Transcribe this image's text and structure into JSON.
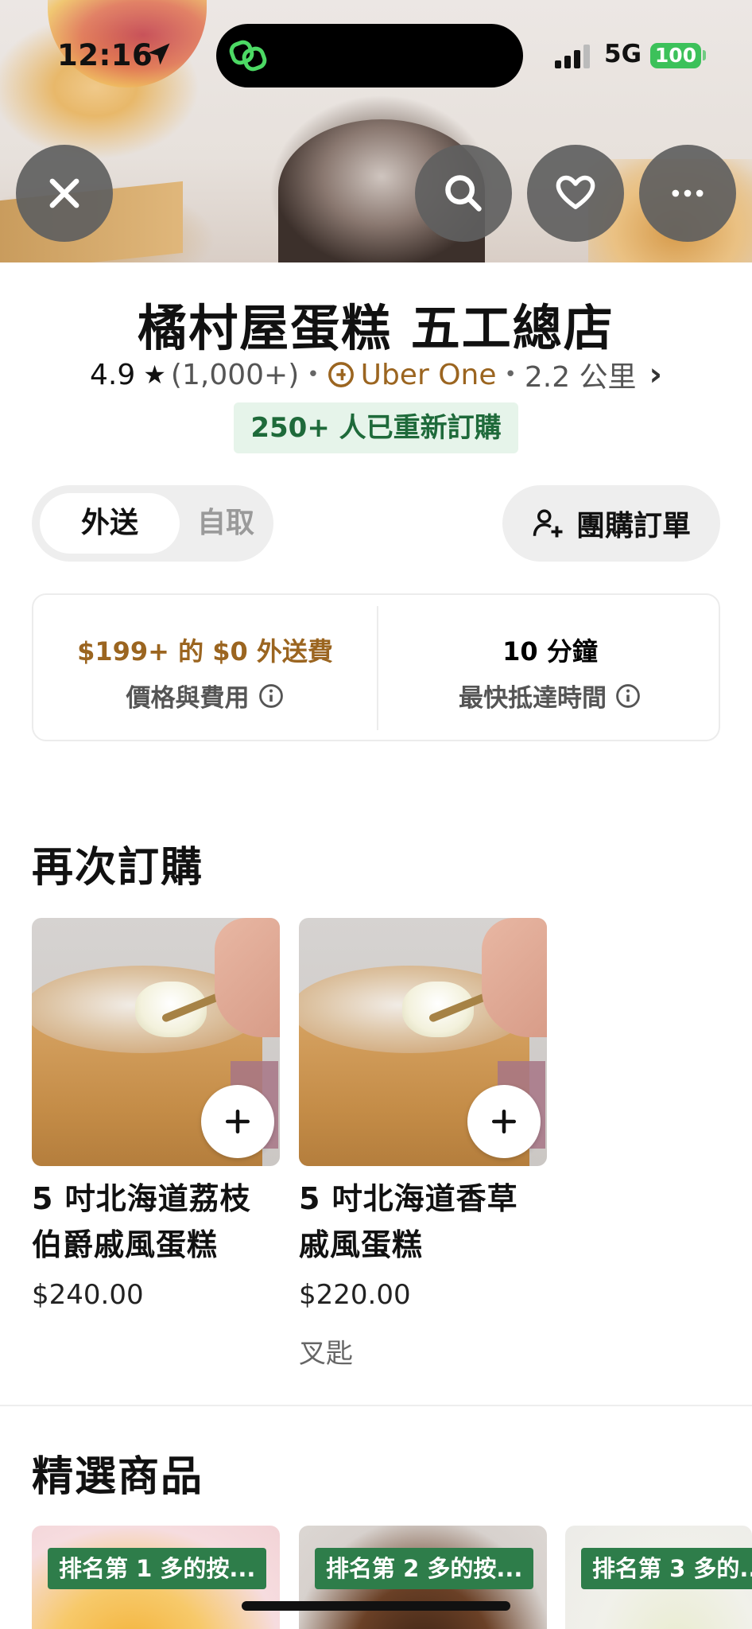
{
  "status_bar": {
    "time": "12:16",
    "network": "5G",
    "battery": "100"
  },
  "store": {
    "name": "橘村屋蛋糕 五工總店",
    "rating": "4.9",
    "review_count": "(1,000+)",
    "membership": "Uber One",
    "distance": "2.2 公里",
    "reorder_badge": "250+ 人已重新訂購"
  },
  "mode_toggle": {
    "delivery": "外送",
    "pickup": "自取",
    "selected": "外送"
  },
  "group_order": {
    "label": "團購訂單"
  },
  "info": {
    "fee_title": "$199+ 的 $0 外送費",
    "fee_sub": "價格與費用",
    "time_title": "10 分鐘",
    "time_sub": "最快抵達時間"
  },
  "buy_again": {
    "title": "再次訂購",
    "items": [
      {
        "name": "5 吋北海道荔枝伯爵戚風蛋糕",
        "price": "$240.00",
        "note": ""
      },
      {
        "name": "5 吋北海道香草戚風蛋糕",
        "price": "$220.00",
        "note": "叉匙"
      }
    ]
  },
  "featured": {
    "title": "精選商品",
    "items": [
      {
        "badge": "排名第 1 多的按..."
      },
      {
        "badge": "排名第 2 多的按..."
      },
      {
        "badge": "排名第 3 多的..."
      }
    ]
  },
  "colors": {
    "accent_brown": "#9b6520",
    "badge_green": "#2e7d4a",
    "reorder_bg": "#e6f4ea",
    "battery_green": "#3cc15a"
  },
  "icons": [
    "location-arrow-icon",
    "link-icon",
    "signal-icon",
    "close-icon",
    "search-icon",
    "heart-icon",
    "more-icon",
    "star-icon",
    "uber-one-icon",
    "chevron-right-icon",
    "add-person-icon",
    "info-icon",
    "plus-icon"
  ]
}
